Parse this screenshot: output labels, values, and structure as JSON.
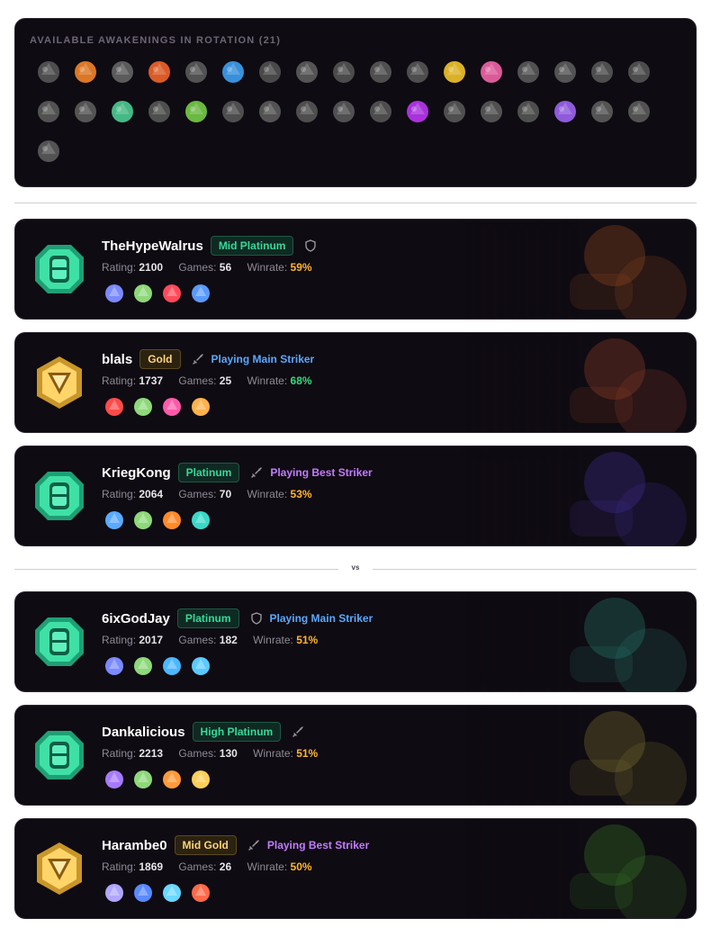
{
  "awakenings": {
    "title": "AVAILABLE AWAKENINGS IN ROTATION (21)",
    "icons": [
      {
        "name": "awakening-icon-1",
        "color": "#5a5a5a"
      },
      {
        "name": "awakening-icon-2",
        "color": "#ff8b2a"
      },
      {
        "name": "awakening-icon-3",
        "color": "#6a6a6a"
      },
      {
        "name": "awakening-icon-4",
        "color": "#ff6a2a"
      },
      {
        "name": "awakening-icon-5",
        "color": "#5f5f5f"
      },
      {
        "name": "awakening-icon-6",
        "color": "#3fa8ff"
      },
      {
        "name": "awakening-icon-7",
        "color": "#555555"
      },
      {
        "name": "awakening-icon-8",
        "color": "#626262"
      },
      {
        "name": "awakening-icon-9",
        "color": "#575757"
      },
      {
        "name": "awakening-icon-10",
        "color": "#5c5c5c"
      },
      {
        "name": "awakening-icon-11",
        "color": "#5a5a5a"
      },
      {
        "name": "awakening-icon-12",
        "color": "#ffd02a"
      },
      {
        "name": "awakening-icon-13",
        "color": "#ff6ab2"
      },
      {
        "name": "awakening-icon-14",
        "color": "#5e5e5e"
      },
      {
        "name": "awakening-icon-15",
        "color": "#606060"
      },
      {
        "name": "awakening-icon-16",
        "color": "#5a5a5a"
      },
      {
        "name": "awakening-icon-17",
        "color": "#585858"
      },
      {
        "name": "awakening-icon-18",
        "color": "#5f5f5f"
      },
      {
        "name": "awakening-icon-19",
        "color": "#616161"
      },
      {
        "name": "awakening-icon-20",
        "color": "#4fd89a"
      },
      {
        "name": "awakening-icon-21",
        "color": "#5c5c5c"
      },
      {
        "name": "awakening-icon-22",
        "color": "#7ad84a"
      },
      {
        "name": "awakening-icon-23",
        "color": "#5a5a5a"
      },
      {
        "name": "awakening-icon-24",
        "color": "#606060"
      },
      {
        "name": "awakening-icon-25",
        "color": "#5b5b5b"
      },
      {
        "name": "awakening-icon-26",
        "color": "#5d5d5d"
      },
      {
        "name": "awakening-icon-27",
        "color": "#595959"
      },
      {
        "name": "awakening-icon-28",
        "color": "#c43aff"
      },
      {
        "name": "awakening-icon-29",
        "color": "#5c5c5c"
      },
      {
        "name": "awakening-icon-30",
        "color": "#5e5e5e"
      },
      {
        "name": "awakening-icon-31",
        "color": "#5a5a5a"
      },
      {
        "name": "awakening-icon-32",
        "color": "#a46aff"
      },
      {
        "name": "awakening-icon-33",
        "color": "#626262"
      },
      {
        "name": "awakening-icon-34",
        "color": "#5f5f5f"
      },
      {
        "name": "awakening-icon-35",
        "color": "#606060"
      }
    ]
  },
  "vs_label": "vs",
  "team_a": [
    {
      "name": "TheHypeWalrus",
      "rank": "Mid Platinum",
      "rank_type": "plat",
      "role_icon": "shield-icon",
      "status": "",
      "status_type": "",
      "rating_label": "Rating:",
      "rating": "2100",
      "games_label": "Games:",
      "games": "56",
      "winrate_label": "Winrate:",
      "winrate": "59%",
      "winrate_tone": "mid",
      "art_color": "#ff7a2a",
      "awakenings": [
        "#7a8aff",
        "#8ed87a",
        "#ff4a5a",
        "#5a9aff"
      ]
    },
    {
      "name": "blals",
      "rank": "Gold",
      "rank_type": "gold",
      "role_icon": "sword-icon",
      "status": "Playing Main Striker",
      "status_type": "main",
      "rating_label": "Rating:",
      "rating": "1737",
      "games_label": "Games:",
      "games": "25",
      "winrate_label": "Winrate:",
      "winrate": "68%",
      "winrate_tone": "good",
      "art_color": "#ff6a3a",
      "awakenings": [
        "#ff4a4a",
        "#8ed87a",
        "#ff5aaa",
        "#ffb24a"
      ]
    },
    {
      "name": "KriegKong",
      "rank": "Platinum",
      "rank_type": "plat",
      "role_icon": "sword-icon",
      "status": "Playing Best Striker",
      "status_type": "best",
      "rating_label": "Rating:",
      "rating": "2064",
      "games_label": "Games:",
      "games": "70",
      "winrate_label": "Winrate:",
      "winrate": "53%",
      "winrate_tone": "mid",
      "art_color": "#6a4aff",
      "awakenings": [
        "#5aaaff",
        "#8ed87a",
        "#ff8a2a",
        "#3ad8c8"
      ]
    }
  ],
  "team_b": [
    {
      "name": "6ixGodJay",
      "rank": "Platinum",
      "rank_type": "plat",
      "role_icon": "shield-icon",
      "status": "Playing Main Striker",
      "status_type": "main",
      "rating_label": "Rating:",
      "rating": "2017",
      "games_label": "Games:",
      "games": "182",
      "winrate_label": "Winrate:",
      "winrate": "51%",
      "winrate_tone": "mid",
      "art_color": "#3ad8b8",
      "awakenings": [
        "#7a8aff",
        "#8ed87a",
        "#4ab8ff",
        "#5acaff"
      ]
    },
    {
      "name": "Dankalicious",
      "rank": "High Platinum",
      "rank_type": "plat",
      "role_icon": "sword-icon",
      "status": "",
      "status_type": "",
      "rating_label": "Rating:",
      "rating": "2213",
      "games_label": "Games:",
      "games": "130",
      "winrate_label": "Winrate:",
      "winrate": "51%",
      "winrate_tone": "mid",
      "art_color": "#d8c84a",
      "awakenings": [
        "#a67aff",
        "#8ed87a",
        "#ff9a3a",
        "#ffcf5a"
      ]
    },
    {
      "name": "Harambe0",
      "rank": "Mid Gold",
      "rank_type": "gold",
      "role_icon": "sword-icon",
      "status": "Playing Best Striker",
      "status_type": "best",
      "rating_label": "Rating:",
      "rating": "1869",
      "games_label": "Games:",
      "games": "26",
      "winrate_label": "Winrate:",
      "winrate": "50%",
      "winrate_tone": "mid",
      "art_color": "#5ad83a",
      "awakenings": [
        "#b0a6ff",
        "#5a8aff",
        "#6ad8ff",
        "#ff6a4a"
      ]
    }
  ]
}
